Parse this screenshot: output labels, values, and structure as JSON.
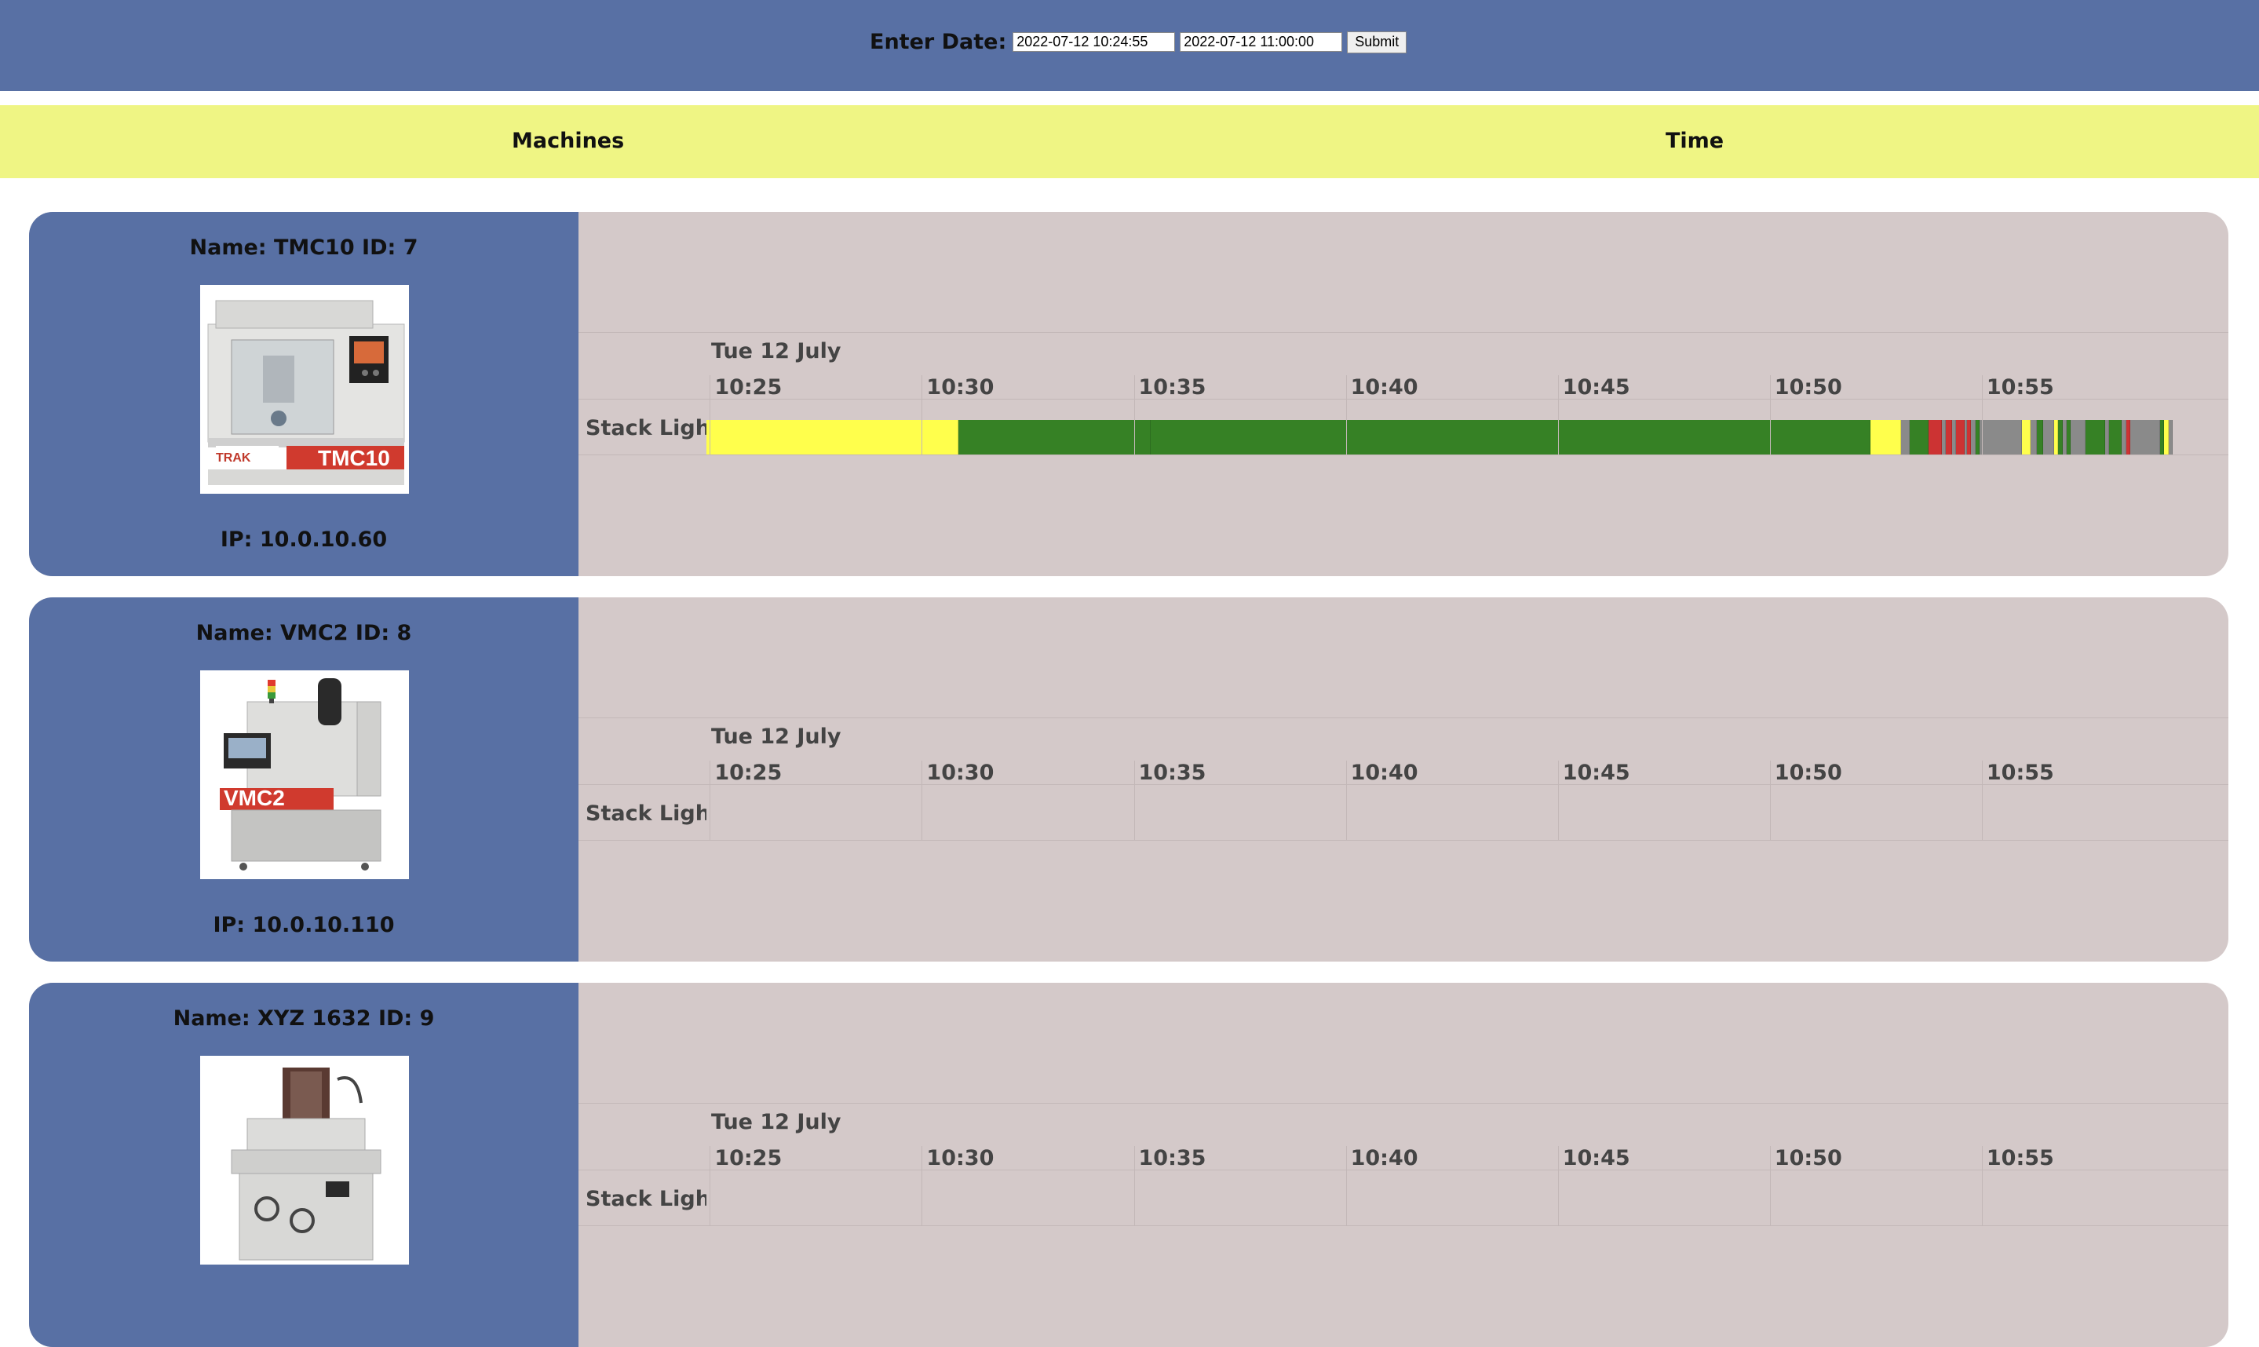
{
  "header": {
    "date_label": "Enter Date:",
    "start_value": "2022-07-12 10:24:55",
    "end_value": "2022-07-12 11:00:00",
    "submit_label": "Submit"
  },
  "columns": {
    "machines": "Machines",
    "time": "Time"
  },
  "timeline": {
    "date_label": "Tue 12 July",
    "ticks": [
      "10:25",
      "10:30",
      "10:35",
      "10:40",
      "10:45",
      "10:50",
      "10:55"
    ],
    "row_label": "Stack Light",
    "range_start_min": 24.92,
    "range_end_min": 60
  },
  "colors": {
    "header_bg": "#5870a4",
    "column_header_bg": "#eff584",
    "card_bg": "#d4c9c9",
    "state_yellow": "#ffff4c",
    "state_green": "#368125",
    "state_red": "#cc3333",
    "state_gray": "#8a8a8a"
  },
  "machines": [
    {
      "name": "Name: TMC10 ID: 7",
      "ip": "IP: 10.0.10.60",
      "image_label": "TMC10",
      "brand_text": "TRAK",
      "states": [
        {
          "start": 24.92,
          "end": 30.87,
          "state": "yellow"
        },
        {
          "start": 30.87,
          "end": 35.4,
          "state": "green"
        },
        {
          "start": 35.4,
          "end": 52.37,
          "state": "green"
        },
        {
          "start": 52.37,
          "end": 53.1,
          "state": "yellow"
        },
        {
          "start": 53.1,
          "end": 53.3,
          "state": "gray"
        },
        {
          "start": 53.3,
          "end": 53.75,
          "state": "green"
        },
        {
          "start": 53.75,
          "end": 54.05,
          "state": "red"
        },
        {
          "start": 54.05,
          "end": 54.15,
          "state": "gray"
        },
        {
          "start": 54.15,
          "end": 54.3,
          "state": "red"
        },
        {
          "start": 54.3,
          "end": 54.4,
          "state": "gray"
        },
        {
          "start": 54.4,
          "end": 54.6,
          "state": "red"
        },
        {
          "start": 54.6,
          "end": 54.65,
          "state": "gray"
        },
        {
          "start": 54.65,
          "end": 54.75,
          "state": "red"
        },
        {
          "start": 54.75,
          "end": 54.85,
          "state": "gray"
        },
        {
          "start": 54.85,
          "end": 54.95,
          "state": "green"
        },
        {
          "start": 54.95,
          "end": 55.95,
          "state": "gray"
        },
        {
          "start": 55.95,
          "end": 56.15,
          "state": "yellow"
        },
        {
          "start": 56.15,
          "end": 56.3,
          "state": "gray"
        },
        {
          "start": 56.3,
          "end": 56.45,
          "state": "green"
        },
        {
          "start": 56.45,
          "end": 56.7,
          "state": "gray"
        },
        {
          "start": 56.7,
          "end": 56.8,
          "state": "yellow"
        },
        {
          "start": 56.8,
          "end": 56.9,
          "state": "green"
        },
        {
          "start": 56.9,
          "end": 57.0,
          "state": "gray"
        },
        {
          "start": 57.0,
          "end": 57.1,
          "state": "green"
        },
        {
          "start": 57.1,
          "end": 57.45,
          "state": "gray"
        },
        {
          "start": 57.45,
          "end": 57.9,
          "state": "green"
        },
        {
          "start": 57.9,
          "end": 58.0,
          "state": "gray"
        },
        {
          "start": 58.0,
          "end": 58.3,
          "state": "green"
        },
        {
          "start": 58.3,
          "end": 58.4,
          "state": "gray"
        },
        {
          "start": 58.4,
          "end": 58.5,
          "state": "red"
        },
        {
          "start": 58.5,
          "end": 59.2,
          "state": "gray"
        },
        {
          "start": 59.2,
          "end": 59.3,
          "state": "green"
        },
        {
          "start": 59.3,
          "end": 59.4,
          "state": "yellow"
        },
        {
          "start": 59.4,
          "end": 59.5,
          "state": "gray"
        }
      ]
    },
    {
      "name": "Name: VMC2 ID: 8",
      "ip": "IP: 10.0.10.110",
      "image_label": "VMC2",
      "brand_text": "",
      "states": []
    },
    {
      "name": "Name: XYZ 1632 ID: 9",
      "ip": "",
      "image_label": "",
      "brand_text": "",
      "states": []
    }
  ]
}
